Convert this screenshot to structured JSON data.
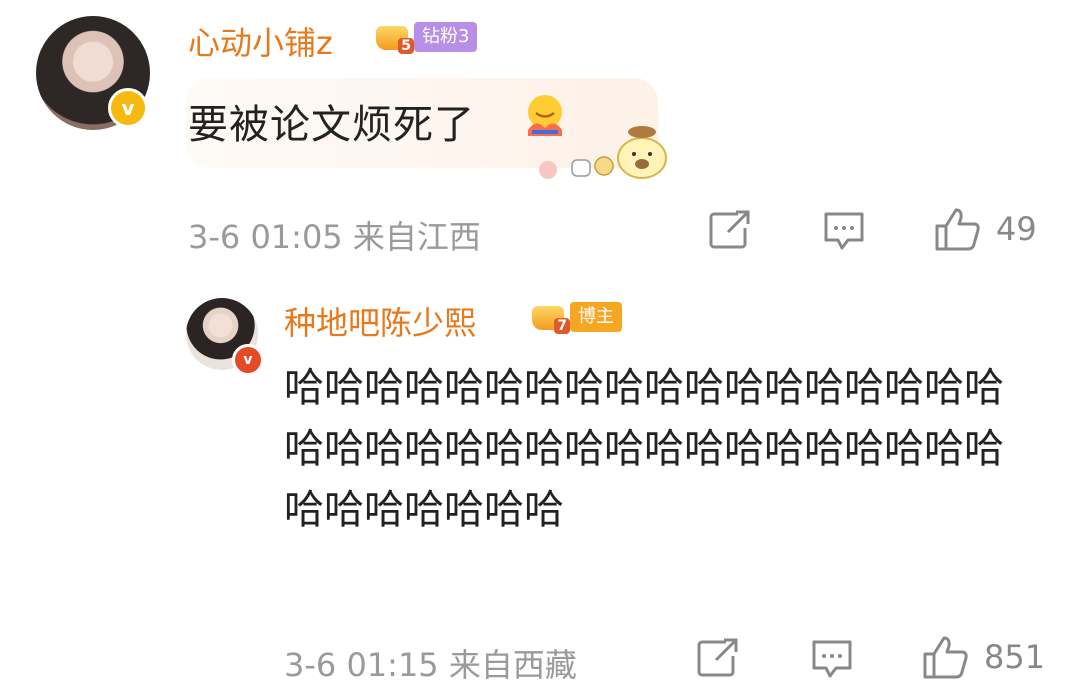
{
  "comments": [
    {
      "username": "心动小铺z",
      "fan_level": "5",
      "fan_tag": "钻粉3",
      "text": "要被论文烦死了",
      "time": "3-6 01:05",
      "location": "来自江西",
      "likes": "49"
    },
    {
      "username": "种地吧陈少熙",
      "fan_level": "7",
      "fan_tag": "博主",
      "text": "哈哈哈哈哈哈哈哈哈哈哈哈哈哈哈哈哈哈哈哈哈哈哈哈哈哈哈哈哈哈哈哈哈哈哈哈哈哈哈哈哈哈哈",
      "time": "3-6 01:15",
      "location": "来自西藏",
      "likes": "851"
    }
  ],
  "icons": {
    "share": "share-icon",
    "comment": "comment-icon",
    "like": "thumbs-up-icon",
    "verified": "verified-badge-icon"
  },
  "colors": {
    "username": "#e8781a",
    "meta": "#9a9a9a",
    "fan_tag_purple": "#b88ee6",
    "fan_tag_orange": "#f5a623",
    "verified_yellow": "#f6b90f"
  }
}
